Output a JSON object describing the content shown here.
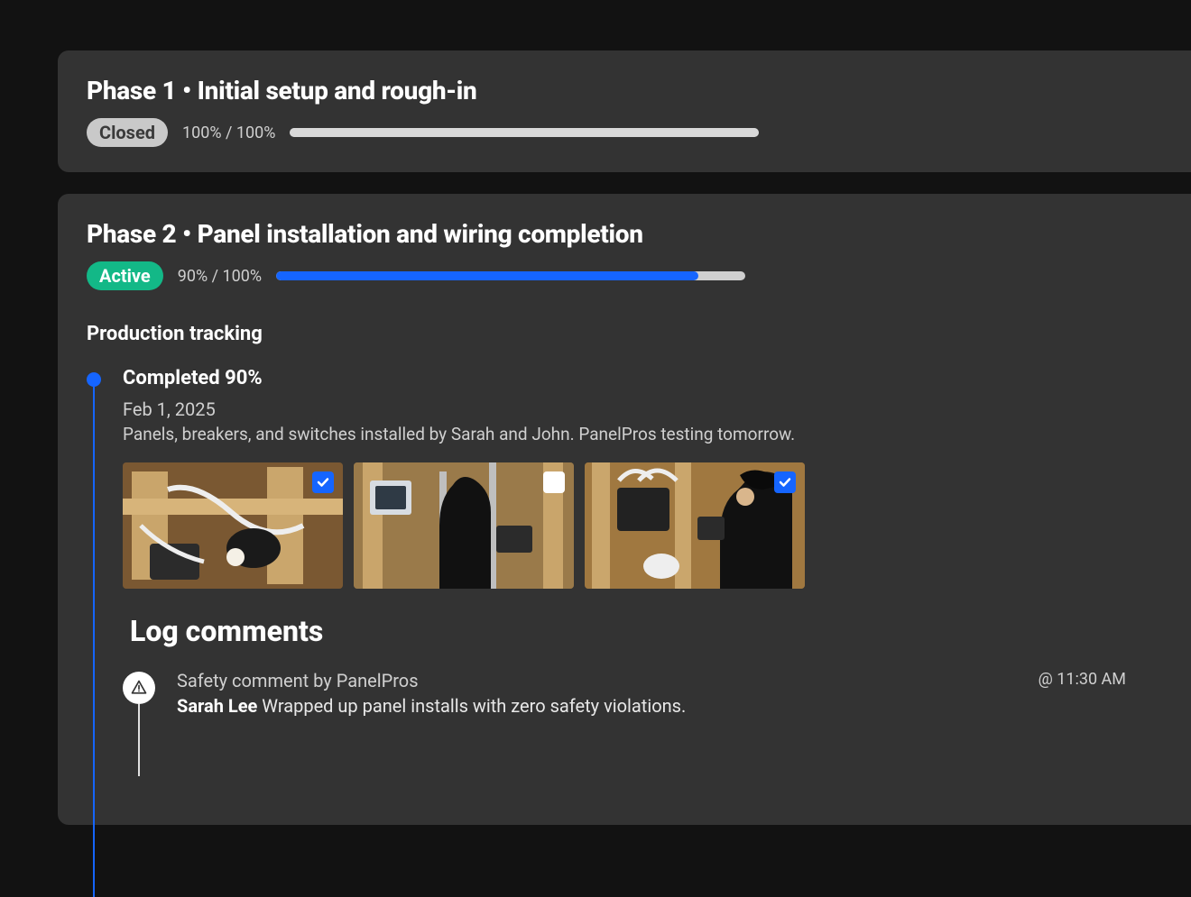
{
  "phase1": {
    "title": "Phase 1 • Initial setup and rough-in",
    "status_label": "Closed",
    "progress_text": "100% / 100%",
    "progress_pct": 100
  },
  "phase2": {
    "title": "Phase 2 • Panel installation and wiring completion",
    "status_label": "Active",
    "progress_text": "90% / 100%",
    "progress_pct": 90,
    "tracking_heading": "Production tracking",
    "entry": {
      "title": "Completed 90%",
      "date": "Feb 1, 2025",
      "desc": "Panels, breakers, and switches installed by Sarah and John. PanelPros testing tomorrow.",
      "photos": [
        {
          "checked": true
        },
        {
          "checked": false
        },
        {
          "checked": true
        }
      ]
    },
    "log_heading": "Log comments",
    "comment": {
      "meta": "Safety comment by PanelPros",
      "author": "Sarah Lee",
      "text": "Wrapped up panel installs with zero safety violations.",
      "time": "@ 11:30 AM"
    }
  }
}
